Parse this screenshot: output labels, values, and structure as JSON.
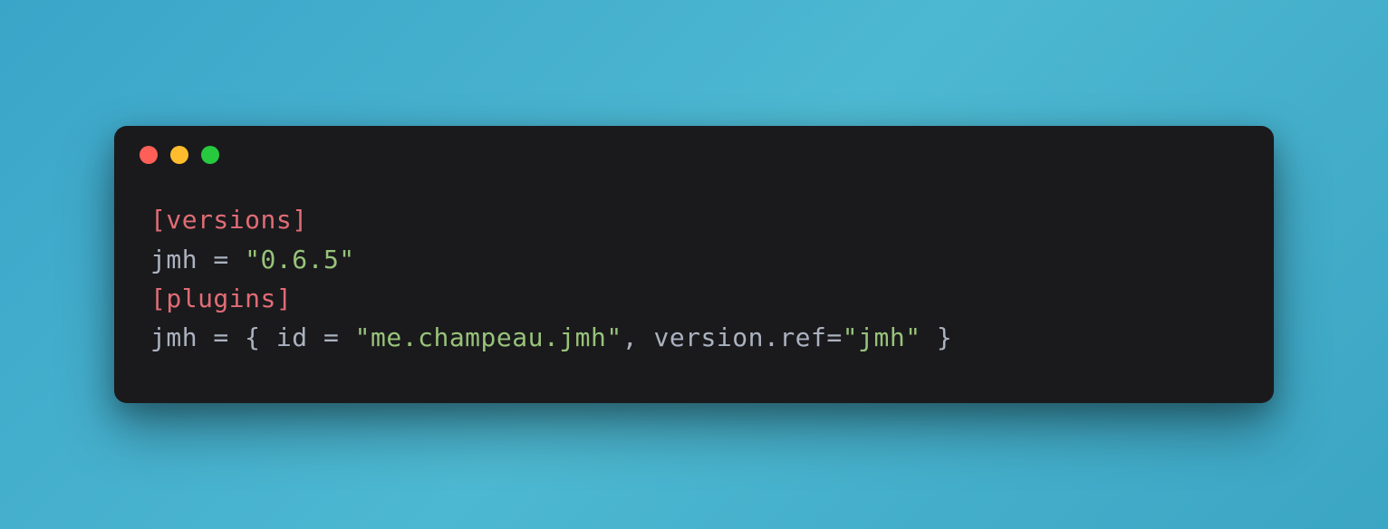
{
  "code": {
    "line1": {
      "section": "[versions]"
    },
    "line2": {
      "key": "jmh",
      "eq": " = ",
      "value": "\"0.6.5\""
    },
    "line3": {
      "section": "[plugins]"
    },
    "line4": {
      "key": "jmh",
      "eq": " = ",
      "open": "{ ",
      "idkey": "id",
      "eq2": " = ",
      "idval": "\"me.champeau.jmh\"",
      "comma": ", ",
      "refkey": "version.ref",
      "eq3": "=",
      "refval": "\"jmh\"",
      "close": " }"
    }
  }
}
